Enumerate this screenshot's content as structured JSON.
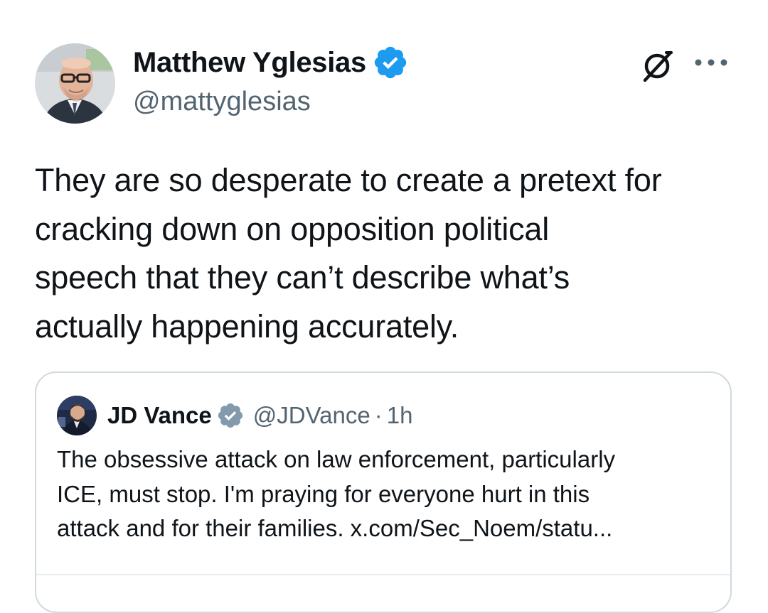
{
  "author": {
    "display_name": "Matthew Yglesias",
    "handle": "@mattyglesias",
    "verified_color": "#1d9bf0"
  },
  "icons": {
    "avatar": "avatar-photo",
    "verified": "verified-badge-icon",
    "grok": "grok-icon",
    "more": "more-options-icon"
  },
  "tweet": {
    "lines": [
      "They are so desperate to create a pretext for",
      "cracking down on opposition political",
      "speech that they can’t describe what’s",
      "actually happening accurately."
    ]
  },
  "quote": {
    "display_name": "JD Vance",
    "handle": "@JDVance",
    "separator": "·",
    "time": "1h",
    "badge_color": "#829aab",
    "lines": [
      "The obsessive attack on law enforcement, particularly",
      "ICE, must stop. I'm praying for everyone hurt in this",
      "attack and for their families. x.com/Sec_Noem/statu..."
    ]
  }
}
